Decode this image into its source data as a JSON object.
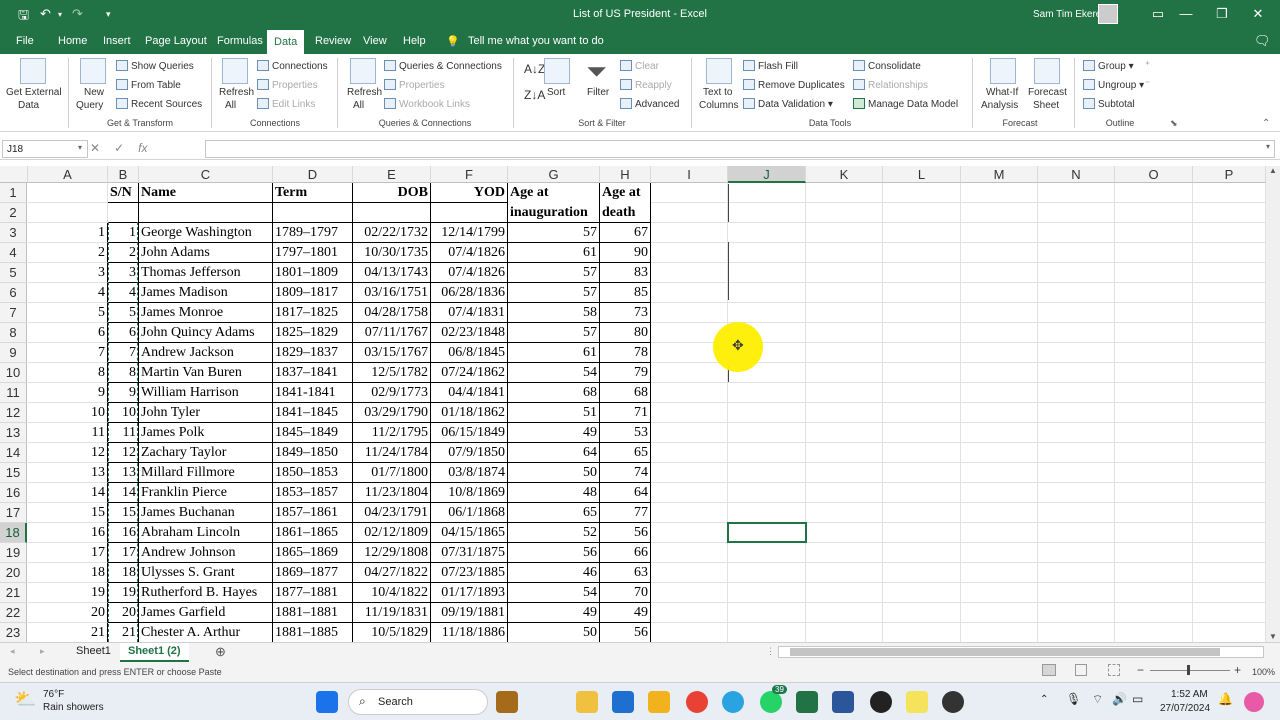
{
  "window": {
    "title": "List of US President  -  Excel",
    "user": "Sam Tim Ekere"
  },
  "menu": [
    "File",
    "Home",
    "Insert",
    "Page Layout",
    "Formulas",
    "Data",
    "Review",
    "View",
    "Help"
  ],
  "menu_active": "Data",
  "tell_me": "Tell me what you want to do",
  "ribbon": {
    "get_external": [
      "Get External",
      "Data"
    ],
    "new_query": [
      "New",
      "Query"
    ],
    "show_queries": "Show Queries",
    "from_table": "From Table",
    "recent_sources": "Recent Sources",
    "grp_get_transform": "Get & Transform",
    "refresh_all": [
      "Refresh",
      "All"
    ],
    "connections": "Connections",
    "properties": "Properties",
    "edit_links": "Edit Links",
    "grp_connections": "Connections",
    "refresh_all2": [
      "Refresh",
      "All"
    ],
    "queries_connections": "Queries & Connections",
    "properties2": "Properties",
    "workbook_links": "Workbook Links",
    "grp_queries": "Queries & Connections",
    "sort": "Sort",
    "filter": "Filter",
    "clear": "Clear",
    "reapply": "Reapply",
    "advanced": "Advanced",
    "grp_sort": "Sort & Filter",
    "text_to_columns": [
      "Text to",
      "Columns"
    ],
    "flash_fill": "Flash Fill",
    "remove_duplicates": "Remove Duplicates",
    "data_validation": "Data Validation",
    "consolidate": "Consolidate",
    "relationships": "Relationships",
    "manage_model": "Manage Data Model",
    "grp_datatools": "Data Tools",
    "whatif": [
      "What-If",
      "Analysis"
    ],
    "forecast_sheet": [
      "Forecast",
      "Sheet"
    ],
    "grp_forecast": "Forecast",
    "group": "Group",
    "ungroup": "Ungroup",
    "subtotal": "Subtotal",
    "grp_outline": "Outline"
  },
  "formula_bar": {
    "name_box": "J18",
    "fx": "fx",
    "content": ""
  },
  "columns": [
    "A",
    "B",
    "C",
    "D",
    "E",
    "F",
    "G",
    "H",
    "I",
    "J",
    "K",
    "L",
    "M",
    "N",
    "O",
    "P"
  ],
  "selected_col": "J",
  "rows": [
    "1",
    "2",
    "3",
    "4",
    "5",
    "6",
    "7",
    "8",
    "9",
    "10",
    "11",
    "12",
    "13",
    "14",
    "15",
    "16",
    "17",
    "18",
    "19",
    "20",
    "21",
    "22",
    "23"
  ],
  "selected_row": "18",
  "headers": {
    "sn": "S/N",
    "name": "Name",
    "term": "Term",
    "dob": "DOB",
    "yod": "YOD",
    "age_inaug_1": "Age at",
    "age_inaug_2": "inauguration",
    "age_death_1": "Age at",
    "age_death_2": "death"
  },
  "table": [
    [
      "1",
      "1",
      "George Washington",
      "1789–1797",
      "02/22/1732",
      "12/14/1799",
      "57",
      "67"
    ],
    [
      "2",
      "2",
      "John Adams",
      "1797–1801",
      "10/30/1735",
      "07/4/1826",
      "61",
      "90"
    ],
    [
      "3",
      "3",
      "Thomas Jefferson",
      "1801–1809",
      "04/13/1743",
      "07/4/1826",
      "57",
      "83"
    ],
    [
      "4",
      "4",
      "James Madison",
      "1809–1817",
      "03/16/1751",
      "06/28/1836",
      "57",
      "85"
    ],
    [
      "5",
      "5",
      "James Monroe",
      "1817–1825",
      "04/28/1758",
      "07/4/1831",
      "58",
      "73"
    ],
    [
      "6",
      "6",
      "John Quincy Adams",
      "1825–1829",
      "07/11/1767",
      "02/23/1848",
      "57",
      "80"
    ],
    [
      "7",
      "7",
      "Andrew Jackson",
      "1829–1837",
      "03/15/1767",
      "06/8/1845",
      "61",
      "78"
    ],
    [
      "8",
      "8",
      "Martin Van Buren",
      "1837–1841",
      "12/5/1782",
      "07/24/1862",
      "54",
      "79"
    ],
    [
      "9",
      "9",
      "William Harrison",
      "1841-1841",
      "02/9/1773",
      "04/4/1841",
      "68",
      "68"
    ],
    [
      "10",
      "10",
      "John Tyler",
      "1841–1845",
      "03/29/1790",
      "01/18/1862",
      "51",
      "71"
    ],
    [
      "11",
      "11",
      "James Polk",
      "1845–1849",
      "11/2/1795",
      "06/15/1849",
      "49",
      "53"
    ],
    [
      "12",
      "12",
      "Zachary Taylor",
      "1849–1850",
      "11/24/1784",
      "07/9/1850",
      "64",
      "65"
    ],
    [
      "13",
      "13",
      "Millard Fillmore",
      "1850–1853",
      "01/7/1800",
      "03/8/1874",
      "50",
      "74"
    ],
    [
      "14",
      "14",
      "Franklin Pierce",
      "1853–1857",
      "11/23/1804",
      "10/8/1869",
      "48",
      "64"
    ],
    [
      "15",
      "15",
      "James Buchanan",
      "1857–1861",
      "04/23/1791",
      "06/1/1868",
      "65",
      "77"
    ],
    [
      "16",
      "16",
      "Abraham Lincoln",
      "1861–1865",
      "02/12/1809",
      "04/15/1865",
      "52",
      "56"
    ],
    [
      "17",
      "17",
      "Andrew Johnson",
      "1865–1869",
      "12/29/1808",
      "07/31/1875",
      "56",
      "66"
    ],
    [
      "18",
      "18",
      "Ulysses S. Grant",
      "1869–1877",
      "04/27/1822",
      "07/23/1885",
      "46",
      "63"
    ],
    [
      "19",
      "19",
      "Rutherford B. Hayes",
      "1877–1881",
      "10/4/1822",
      "01/17/1893",
      "54",
      "70"
    ],
    [
      "20",
      "20",
      "James Garfield",
      "1881–1881",
      "11/19/1831",
      "09/19/1881",
      "49",
      "49"
    ],
    [
      "21",
      "21",
      "Chester A. Arthur",
      "1881–1885",
      "10/5/1829",
      "11/18/1886",
      "50",
      "56"
    ]
  ],
  "sheets": [
    "Sheet1",
    "Sheet1 (2)"
  ],
  "active_sheet": "Sheet1 (2)",
  "status": {
    "message": "Select destination and press ENTER or choose Paste",
    "zoom": "100%"
  },
  "taskbar": {
    "weather_temp": "76°F",
    "weather_desc": "Rain showers",
    "search": "Search",
    "time": "1:52 AM",
    "date": "27/07/2024",
    "badge": "39"
  },
  "colors": {
    "excel_green": "#217346",
    "selected_header": "#d2d2d2"
  }
}
